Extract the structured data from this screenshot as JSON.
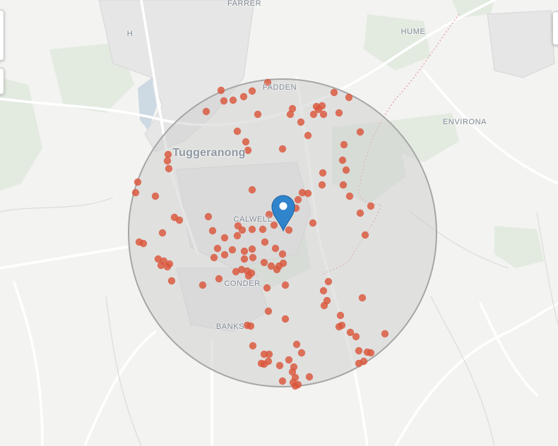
{
  "map": {
    "place_labels": [
      {
        "id": "farrer",
        "text": "FARRER",
        "kind": "suburb"
      },
      {
        "id": "h",
        "text": "H",
        "kind": "suburb"
      },
      {
        "id": "hume",
        "text": "HUME",
        "kind": "suburb"
      },
      {
        "id": "fadden",
        "text": "FADDEN",
        "kind": "suburb"
      },
      {
        "id": "environa",
        "text": "ENVIRONA",
        "kind": "suburb"
      },
      {
        "id": "tuggeranong",
        "text": "Tuggeranong",
        "kind": "city"
      },
      {
        "id": "calwell",
        "text": "CALWELL",
        "kind": "suburb"
      },
      {
        "id": "conder",
        "text": "CONDER",
        "kind": "suburb"
      },
      {
        "id": "banks",
        "text": "BANKS",
        "kind": "suburb"
      }
    ],
    "colors": {
      "marker_dot": "#d9553a",
      "radius_fill": "#cfcfcf",
      "radius_stroke": "#a9a9a9",
      "pin": "#2f84cc"
    },
    "icons": {
      "location_pin": "map-pin-icon",
      "zoom_controls": "zoom-control"
    }
  }
}
